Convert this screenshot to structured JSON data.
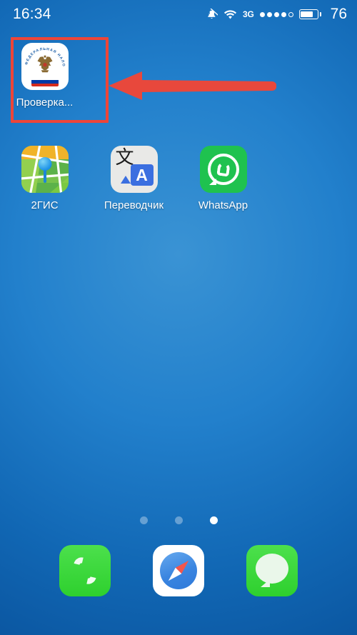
{
  "status_bar": {
    "clock": "16:34",
    "mute_icon": "mute-bell-icon",
    "wifi_icon": "wifi-icon",
    "network_label": "3G",
    "signal_dots_total": 5,
    "signal_dots_filled": 4,
    "battery_percent": "76",
    "battery_level": 76
  },
  "home_screen": {
    "apps_row1": [
      {
        "label": "Проверка...",
        "icon": "fns-tax-service-icon",
        "highlighted": true
      }
    ],
    "apps_row2": [
      {
        "label": "2ГИС",
        "icon": "2gis-map-icon"
      },
      {
        "label": "Переводчик",
        "icon": "translate-icon"
      },
      {
        "label": "WhatsApp",
        "icon": "whatsapp-icon"
      }
    ],
    "fns_icon_text": {
      "ring_text": "ФЕДЕРАЛЬНАЯ НАЛОГОВАЯ СЛУЖБА",
      "emblem": "double-headed-eagle",
      "flag_colors": [
        "#ffffff",
        "#0039a6",
        "#d52b1e"
      ]
    },
    "translate_icon_glyphs": {
      "source": "文",
      "target": "A"
    },
    "page_dots": {
      "count": 3,
      "active_index": 2
    },
    "dock": [
      {
        "label": "Phone",
        "icon": "phone-icon"
      },
      {
        "label": "Safari",
        "icon": "safari-compass-icon"
      },
      {
        "label": "Messages",
        "icon": "messages-icon"
      }
    ]
  },
  "annotation": {
    "highlight_box_color": "#ee4538",
    "arrow_color": "#e8483c",
    "arrow_direction": "left",
    "arrow_points_to": "Проверка..."
  },
  "colors": {
    "wallpaper_top": "#3a93d4",
    "wallpaper_mid": "#2280cc",
    "wallpaper_bottom": "#0a549e",
    "accent_red": "#ee4538",
    "green": "#2ed02e"
  }
}
